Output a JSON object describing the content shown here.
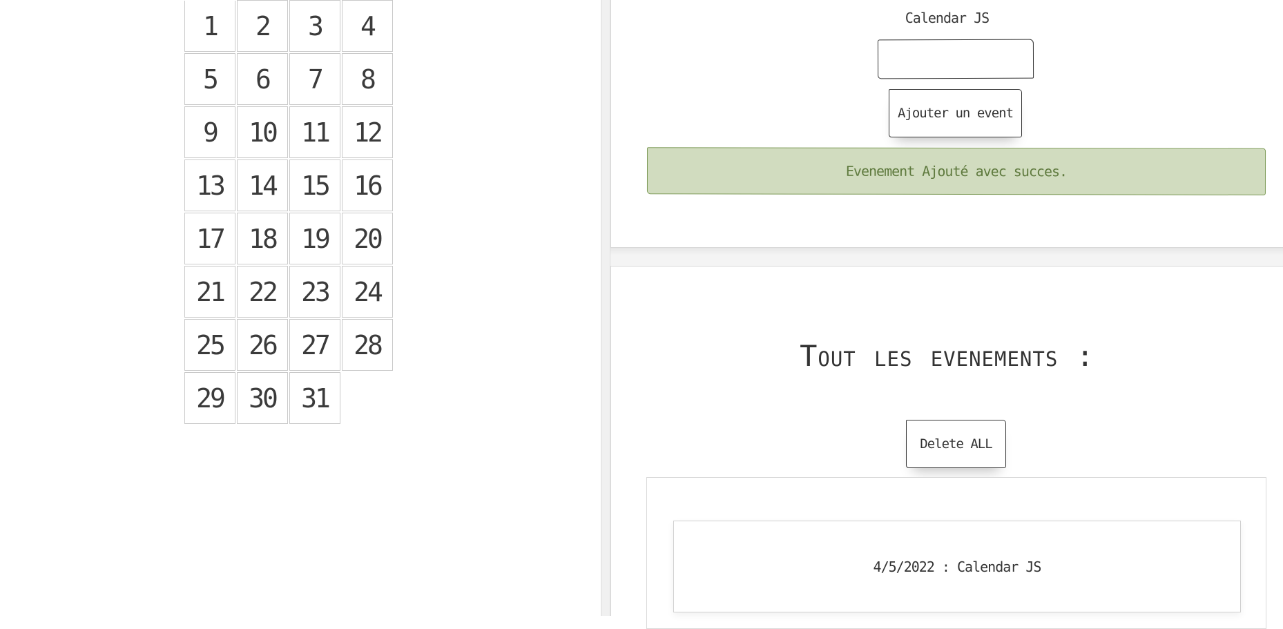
{
  "calendar": {
    "days": [
      "1",
      "2",
      "3",
      "4",
      "5",
      "6",
      "7",
      "8",
      "9",
      "10",
      "11",
      "12",
      "13",
      "14",
      "15",
      "16",
      "17",
      "18",
      "19",
      "20",
      "21",
      "22",
      "23",
      "24",
      "25",
      "26",
      "27",
      "28",
      "29",
      "30",
      "31"
    ]
  },
  "form": {
    "label": "Calendar JS",
    "input_value": "",
    "add_button_label": "Ajouter un event",
    "success_message": "Evenement Ajouté avec succes."
  },
  "events": {
    "title": "Tout les evenements :",
    "delete_all_label": "Delete ALL",
    "items": [
      {
        "text": "4/5/2022 : Calendar JS"
      }
    ]
  },
  "colors": {
    "success_bg": "#d1dcbf",
    "success_border": "#7f9c5a",
    "success_text": "#5f7a3e",
    "text": "#333333"
  }
}
